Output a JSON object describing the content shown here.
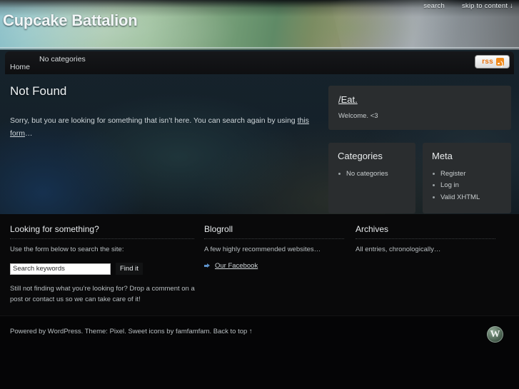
{
  "header": {
    "site_title": "Cupcake Battalion",
    "top_links": [
      {
        "label": "search",
        "name": "search-link"
      },
      {
        "label": "skip to content ↓",
        "name": "skip-to-content-link"
      }
    ]
  },
  "nav": {
    "home_label": "Home",
    "categories_label": "No categories",
    "rss_label": "rss"
  },
  "main": {
    "title": "Not Found",
    "body_before": "Sorry, but you are looking for something that isn’t here. You can search again by using ",
    "body_link": "this form",
    "body_after": "…"
  },
  "sidebar": {
    "intro": {
      "title": "/Eat.",
      "text": "Welcome. <3"
    },
    "categories": {
      "title": "Categories",
      "items": [
        "No categories"
      ]
    },
    "meta": {
      "title": "Meta",
      "items": [
        "Register",
        "Log in",
        "Valid XHTML"
      ]
    }
  },
  "footer_widgets": {
    "search": {
      "title": "Looking for something?",
      "intro": "Use the form below to search the site:",
      "input_value": "Search keywords",
      "input_placeholder": "Search keywords",
      "button_label": "Find it",
      "outro": "Still not finding what you’re looking for? Drop a comment on a post or contact us so we can take care of it!"
    },
    "blogroll": {
      "title": "Blogroll",
      "text": "A few highly recommended websites…",
      "links": [
        "Our Facebook"
      ]
    },
    "archives": {
      "title": "Archives",
      "text": "All entries, chronologically…"
    }
  },
  "footer": {
    "credit": "Powered by WordPress. Theme: Pixel. Sweet icons by famfamfam. Back to top ↑",
    "logo_letter": "W"
  },
  "colors": {
    "rss_orange": "#e8700a",
    "panel": "#2a2d2f",
    "footer_bg": "#09090a",
    "link_blue": "#5c90c8"
  }
}
